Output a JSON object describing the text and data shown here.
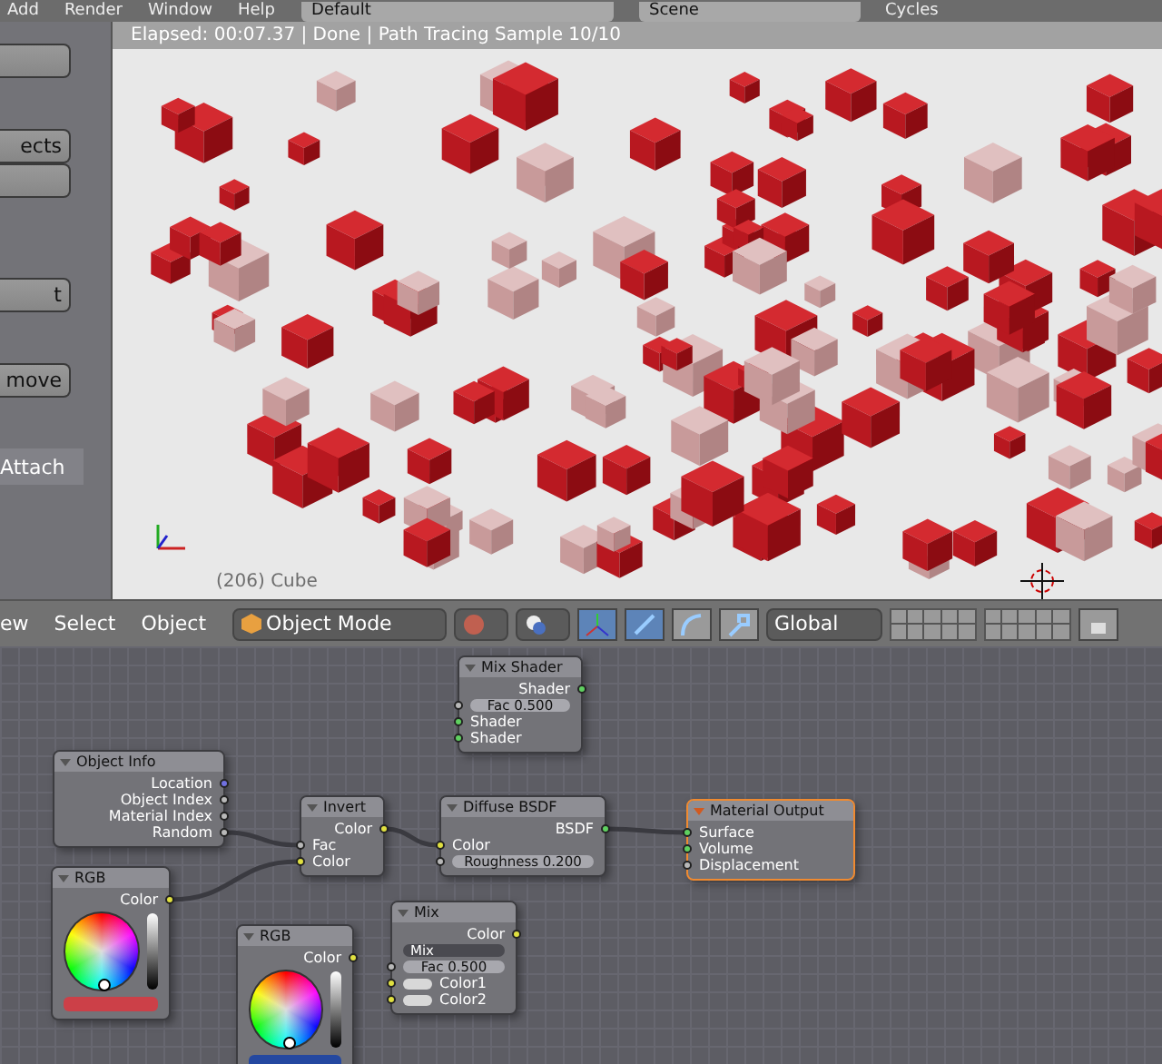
{
  "topbar": {
    "menus": [
      "Add",
      "Render",
      "Window",
      "Help"
    ],
    "layout": "Default",
    "scene": "Scene",
    "engine": "Cycles"
  },
  "tool_panel": {
    "buttons": [
      {
        "kind": "blank"
      },
      {
        "kind": "text",
        "label": "ects"
      },
      {
        "kind": "blank"
      },
      {
        "kind": "text",
        "label": "t"
      },
      {
        "kind": "text",
        "label": "move"
      }
    ],
    "tab": "Attach"
  },
  "viewport": {
    "status": "Elapsed: 00:07.37 | Done | Path Tracing Sample 10/10",
    "object_label": "(206) Cube"
  },
  "view_header": {
    "menus": [
      "ew",
      "Select",
      "Object"
    ],
    "mode": "Object Mode",
    "orientation": "Global",
    "manipulators": [
      {
        "selected": true
      },
      {
        "selected": true
      },
      {
        "selected": false
      },
      {
        "selected": false
      }
    ]
  },
  "nodes": [
    {
      "title": "Mix Shader",
      "selected": false,
      "rows": [
        {
          "kind": "output",
          "label": "Shader",
          "color": "#5fd060"
        },
        {
          "kind": "field",
          "label": "Fac 0.500",
          "color": "#b8b8b8"
        },
        {
          "kind": "input",
          "label": "Shader",
          "color": "#5fd060"
        },
        {
          "kind": "input",
          "label": "Shader",
          "color": "#5fd060"
        }
      ]
    },
    {
      "title": "Object Info",
      "selected": false,
      "rows": [
        {
          "kind": "output",
          "label": "Location",
          "color": "#7070e0"
        },
        {
          "kind": "output",
          "label": "Object Index",
          "color": "#b8b8b8"
        },
        {
          "kind": "output",
          "label": "Material Index",
          "color": "#b8b8b8"
        },
        {
          "kind": "output",
          "label": "Random",
          "color": "#b8b8b8"
        }
      ]
    },
    {
      "title": "Invert",
      "selected": false,
      "rows": [
        {
          "kind": "output",
          "label": "Color",
          "color": "#e0e040"
        },
        {
          "kind": "input",
          "label": "Fac",
          "color": "#b8b8b8"
        },
        {
          "kind": "input",
          "label": "Color",
          "color": "#e0e040"
        }
      ]
    },
    {
      "title": "Diffuse BSDF",
      "selected": false,
      "rows": [
        {
          "kind": "output",
          "label": "BSDF",
          "color": "#5fd060"
        },
        {
          "kind": "input",
          "label": "Color",
          "color": "#e0e040"
        },
        {
          "kind": "field",
          "label": "Roughness 0.200",
          "color": "#b8b8b8"
        }
      ]
    },
    {
      "title": "Material Output",
      "selected": true,
      "rows": [
        {
          "kind": "input",
          "label": "Surface",
          "color": "#5fd060"
        },
        {
          "kind": "input",
          "label": "Volume",
          "color": "#5fd060"
        },
        {
          "kind": "input",
          "label": "Displacement",
          "color": "#b8b8b8"
        }
      ]
    },
    {
      "title": "RGB",
      "selected": false,
      "rows": [
        {
          "kind": "output",
          "label": "Color",
          "color": "#e0e040"
        },
        {
          "kind": "wheel"
        },
        {
          "kind": "swatch",
          "color": "#cc4048"
        }
      ]
    },
    {
      "title": "RGB",
      "selected": false,
      "rows": [
        {
          "kind": "output",
          "label": "Color",
          "color": "#e0e040"
        },
        {
          "kind": "wheel"
        },
        {
          "kind": "swatch",
          "color": "#2448a0"
        }
      ]
    },
    {
      "title": "Mix",
      "selected": false,
      "rows": [
        {
          "kind": "output",
          "label": "Color",
          "color": "#e0e040"
        },
        {
          "kind": "dropdown",
          "label": "Mix"
        },
        {
          "kind": "field",
          "label": "Fac 0.500",
          "color": "#b8b8b8"
        },
        {
          "kind": "color_input",
          "label": "Color1",
          "color": "#e0e040"
        },
        {
          "kind": "color_input",
          "label": "Color2",
          "color": "#e0e040"
        }
      ]
    }
  ]
}
